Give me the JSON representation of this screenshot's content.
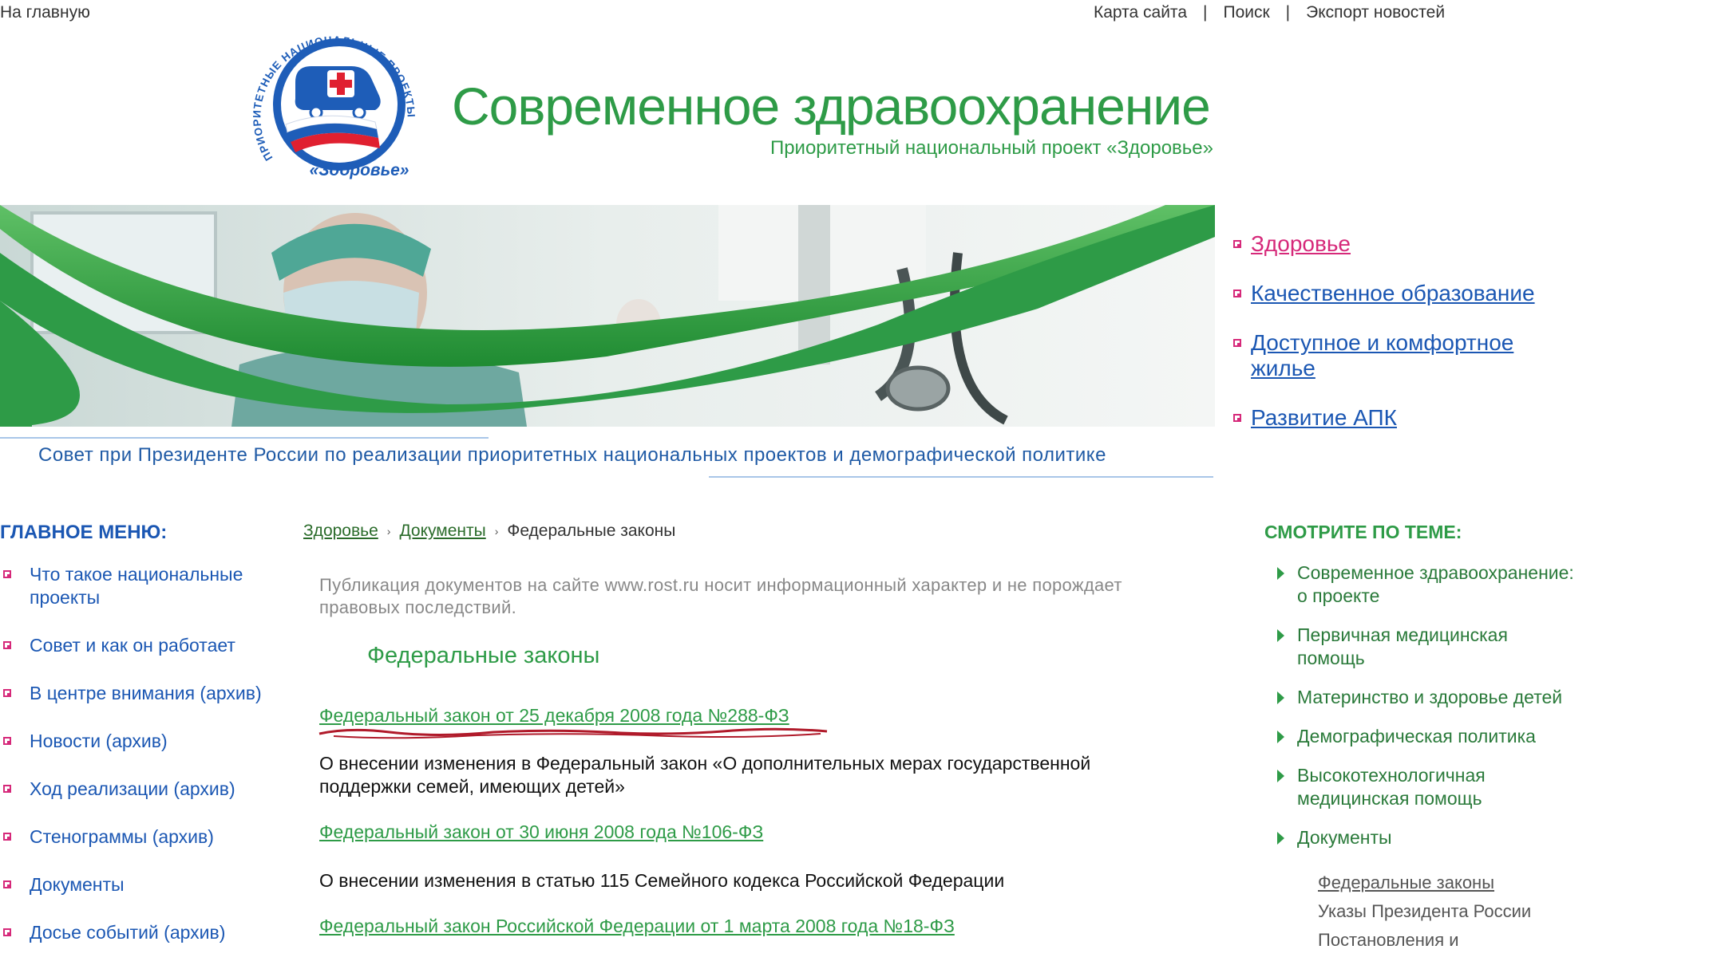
{
  "top": {
    "home": "На главную",
    "nav": [
      "Карта сайта",
      "Поиск",
      "Экспорт новостей"
    ],
    "nav_sep": "|"
  },
  "logo": {
    "ring_text": "ПРИОРИТЕТНЫЕ НАЦИОНАЛЬНЫЕ ПРОЕКТЫ",
    "label": "«Здоровье»"
  },
  "site": {
    "title": "Современное здравоохранение",
    "subtitle": "Приоритетный национальный проект «Здоровье»"
  },
  "projects": [
    {
      "label": "Здоровье",
      "active": true
    },
    {
      "label": "Качественное образование"
    },
    {
      "label": "Доступное и комфортное жилье"
    },
    {
      "label": "Развитие АПК"
    }
  ],
  "council": "Совет при Президенте России по реализации приоритетных национальных проектов и демографической политике",
  "left_menu": {
    "title": "ГЛАВНОЕ МЕНЮ:",
    "items": [
      "Что такое национальные проекты",
      "Совет и как он работает",
      "В центре внимания (архив)",
      "Новости (архив)",
      "Ход реализации (архив)",
      "Стенограммы (архив)",
      "Документы",
      "Досье событий (архив)"
    ]
  },
  "breadcrumb": {
    "items": [
      "Здоровье",
      "Документы"
    ],
    "current": "Федеральные законы",
    "sep": "›"
  },
  "disclaimer": "Публикация документов на сайте www.rost.ru носит информационный характер и не порождает правовых последствий.",
  "section_title": "Федеральные законы",
  "laws": [
    {
      "title": "Федеральный закон от 25 декабря 2008 года №288-ФЗ",
      "desc": "О внесении изменения в Федеральный закон «О дополнительных мерах государственной поддержки семей, имеющих детей»"
    },
    {
      "title": "Федеральный закон от 30 июня 2008 года №106-ФЗ",
      "desc": "О внесении изменения в статью 115 Семейного кодекса Российской Федерации"
    },
    {
      "title": "Федеральный закон Российской Федерации от 1 марта 2008 года №18-ФЗ",
      "desc": ""
    }
  ],
  "related": {
    "title": "СМОТРИТЕ ПО ТЕМЕ:",
    "items": [
      "Современное здравоохранение: о проекте",
      "Первичная медицинская помощь",
      "Материнство и здоровье детей",
      "Демографическая политика",
      "Высокотехнологичная медицинская помощь",
      "Документы"
    ],
    "sub_items": [
      "Федеральные законы",
      "Указы Президента России",
      "Постановления и"
    ]
  },
  "colors": {
    "green": "#2e9b47",
    "blue": "#1b57b3",
    "pink": "#d6297a",
    "red_annotation": "#b01a2a"
  }
}
